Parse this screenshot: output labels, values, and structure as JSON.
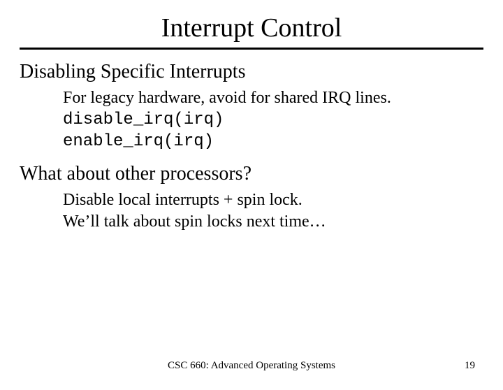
{
  "title": "Interrupt Control",
  "section1": {
    "heading": "Disabling Specific Interrupts",
    "line1": "For legacy hardware, avoid for shared IRQ lines.",
    "code1": "disable_irq(irq)",
    "code2": "enable_irq(irq)"
  },
  "section2": {
    "heading": "What about other processors?",
    "line1": "Disable local interrupts + spin lock.",
    "line2": "We’ll talk about spin locks next time…"
  },
  "footer": {
    "course": "CSC 660: Advanced Operating Systems",
    "page": "19"
  }
}
